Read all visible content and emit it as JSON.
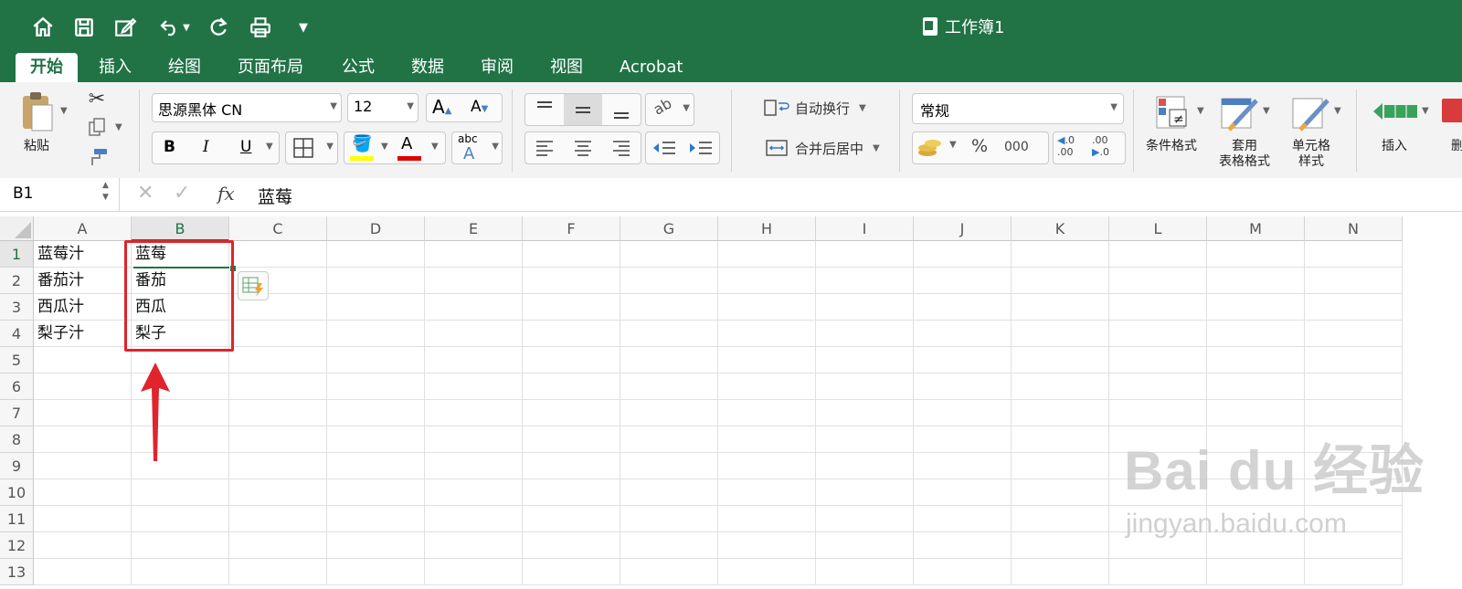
{
  "window": {
    "title": "工作簿1"
  },
  "quick_access": {
    "icons": [
      "home-icon",
      "save-icon",
      "edit-icon",
      "undo-icon",
      "redo-icon",
      "print-icon",
      "customize-icon"
    ]
  },
  "tabs": [
    "开始",
    "插入",
    "绘图",
    "页面布局",
    "公式",
    "数据",
    "审阅",
    "视图",
    "Acrobat"
  ],
  "ribbon": {
    "paste_label": "粘贴",
    "font_name": "思源黑体 CN",
    "font_size": "12",
    "grow_font": "A",
    "shrink_font": "A",
    "bold": "B",
    "italic": "I",
    "underline": "U",
    "font_color_letter": "A",
    "highlight_color": "#ffff00",
    "font_color": "#e00000",
    "abc": "abc",
    "wrap_text": "自动换行",
    "merge_center": "合并后居中",
    "number_format": "常规",
    "percent": "%",
    "thousands": "000",
    "inc_decimal_top": ".0",
    "inc_decimal_bottom": ".00",
    "dec_decimal_top": ".00",
    "dec_decimal_bottom": ".0",
    "conditional_format": "条件格式",
    "table_format_1": "套用",
    "table_format_2": "表格格式",
    "cell_style_1": "单元格",
    "cell_style_2": "样式",
    "insert": "插入",
    "delete_partial": "删"
  },
  "formula_bar": {
    "name_box": "B1",
    "fx": "fx",
    "content": "蓝莓"
  },
  "sheet": {
    "columns": [
      "A",
      "B",
      "C",
      "D",
      "E",
      "F",
      "G",
      "H",
      "I",
      "J",
      "K",
      "L",
      "M",
      "N"
    ],
    "rows": [
      "1",
      "2",
      "3",
      "4",
      "5",
      "6",
      "7",
      "8",
      "9",
      "10",
      "11",
      "12",
      "13"
    ],
    "col_a": [
      "蓝莓汁",
      "番茄汁",
      "西瓜汁",
      "梨子汁"
    ],
    "col_b": [
      "蓝莓",
      "番茄",
      "西瓜",
      "梨子"
    ],
    "selected_cell": "B1"
  },
  "watermark": {
    "brand": "Bai du 经验",
    "url": "jingyan.baidu.com"
  },
  "colors": {
    "excel_green": "#217346",
    "annotation_red": "#e0242b"
  }
}
